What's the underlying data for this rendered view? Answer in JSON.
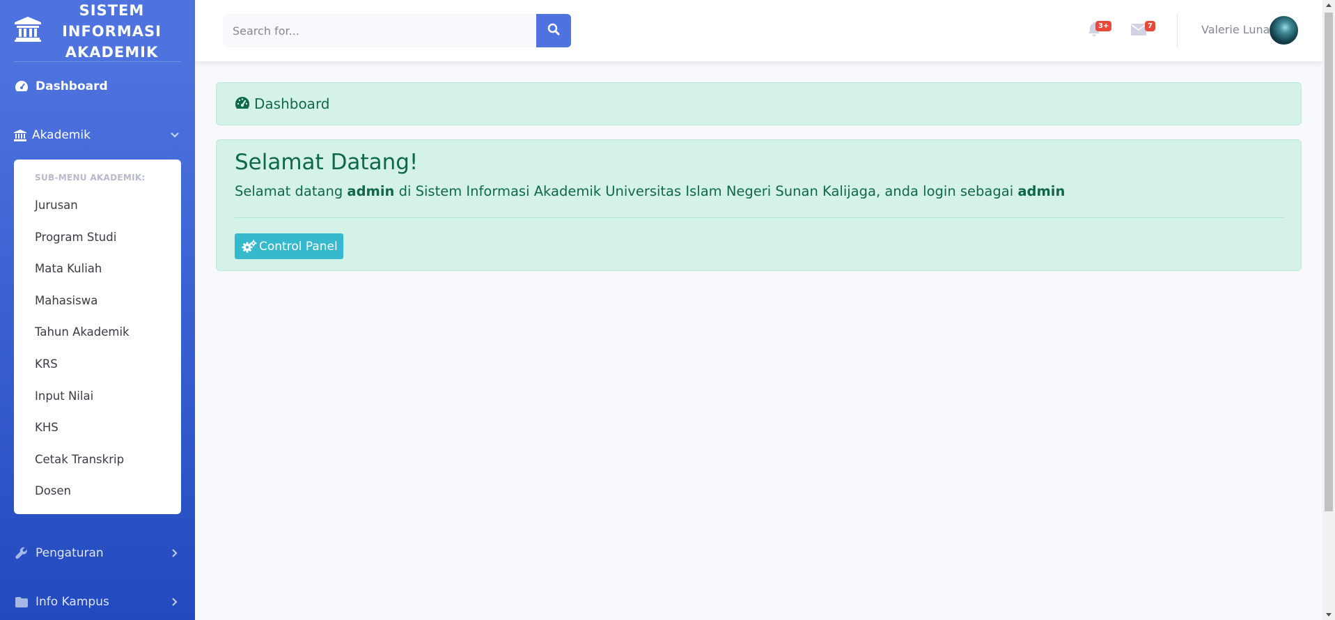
{
  "brand": {
    "line1": "SISTEM",
    "line2": "INFORMASI",
    "line3": "AKADEMIK",
    "icon": "university-icon"
  },
  "sidebar": {
    "dashboard_label": "Dashboard",
    "akademik_label": "Akademik",
    "submenu_header": "SUB-MENU AKADEMIK:",
    "submenu_items": [
      "Jurusan",
      "Program Studi",
      "Mata Kuliah",
      "Mahasiswa",
      "Tahun Akademik",
      "KRS",
      "Input Nilai",
      "KHS",
      "Cetak Transkrip",
      "Dosen"
    ],
    "pengaturan_label": "Pengaturan",
    "info_kampus_label": "Info Kampus"
  },
  "topbar": {
    "search_placeholder": "Search for...",
    "alerts_badge": "3+",
    "messages_badge": "7",
    "user_name": "Valerie Luna"
  },
  "content": {
    "breadcrumb": "Dashboard",
    "welcome_title": "Selamat Datang!",
    "welcome_prefix": "Selamat datang",
    "welcome_user": "admin",
    "welcome_middle": "di Sistem Informasi Akademik Universitas Islam Negeri Sunan Kalijaga, anda login sebagai",
    "welcome_role": "admin",
    "control_panel_label": "Control Panel"
  },
  "colors": {
    "primary": "#4e73df",
    "info": "#36b9cc",
    "danger": "#e74a3b",
    "success_bg": "#d4f2e8",
    "success_text": "#0f6848"
  }
}
